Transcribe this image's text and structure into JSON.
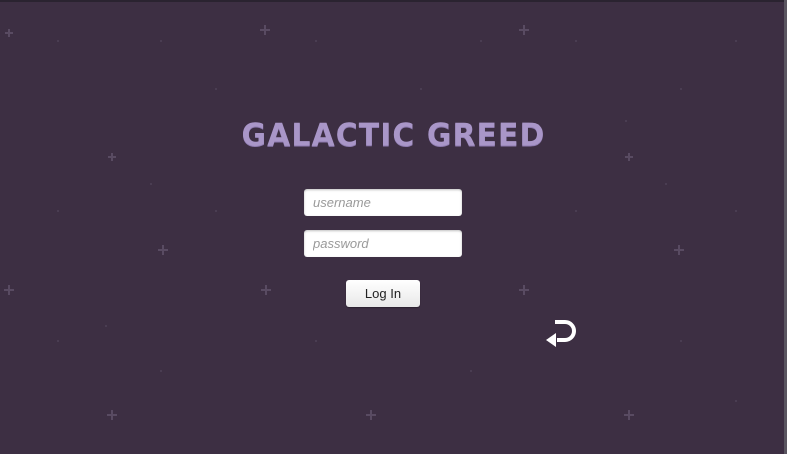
{
  "title": "GALACTIC GREED",
  "login": {
    "username_placeholder": "username",
    "password_placeholder": "password",
    "login_label": "Log In"
  },
  "icons": {
    "back": "return-arrow-icon"
  },
  "colors": {
    "background": "#3d2f43",
    "title": "#a996c8",
    "star": "#5a4c63"
  }
}
